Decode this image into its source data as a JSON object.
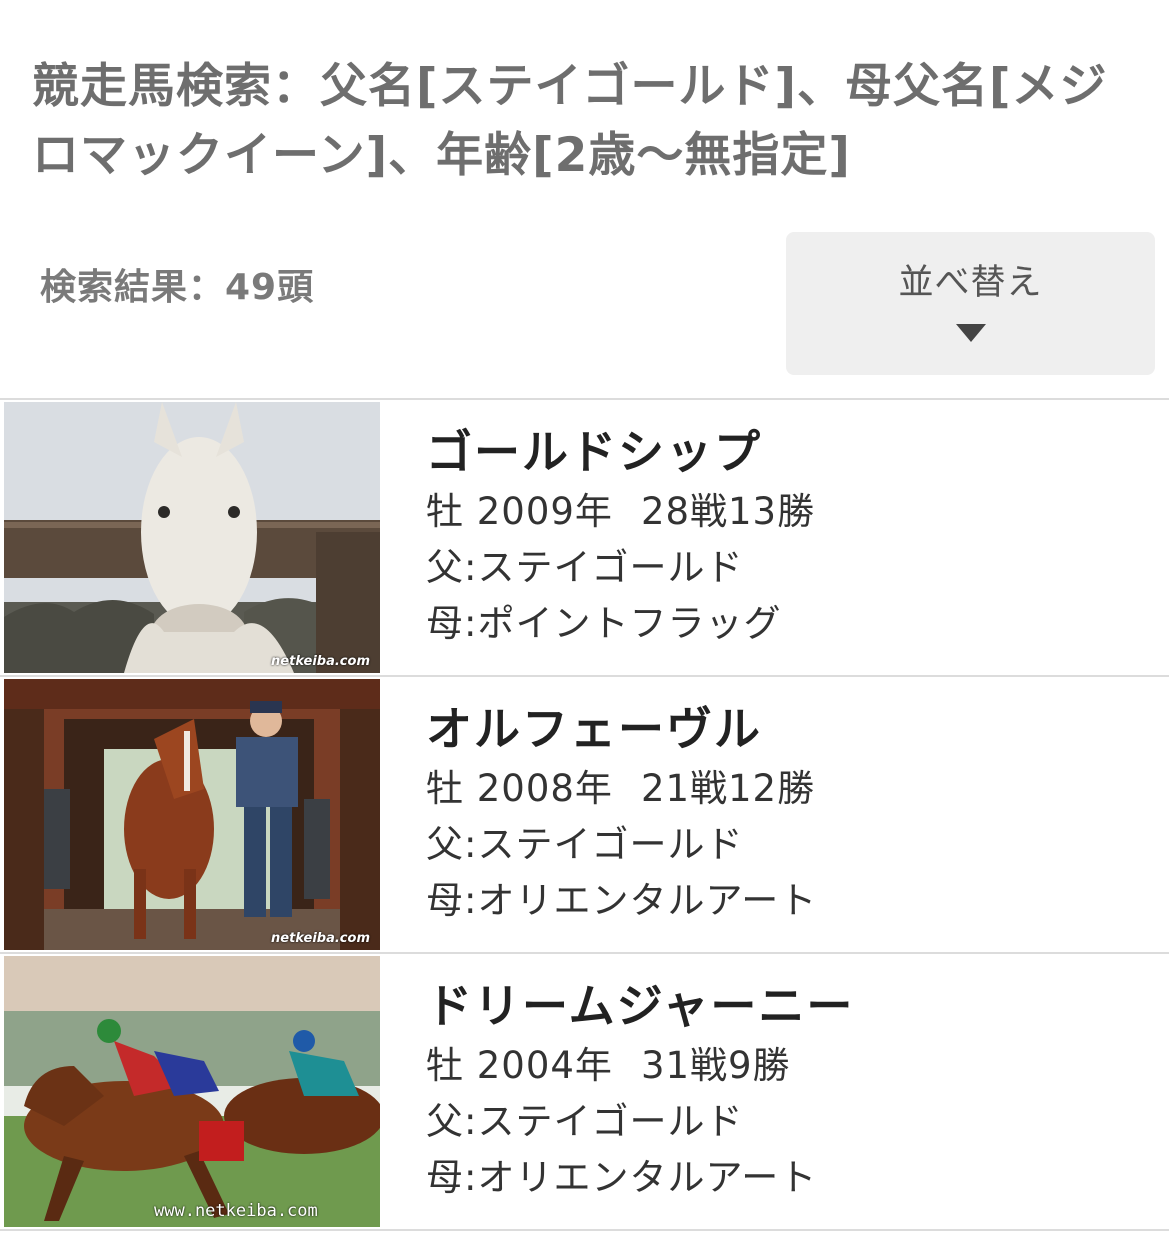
{
  "header": {
    "title": "競走馬検索：父名[ステイゴールド]、母父名[メジロマックイーン]、年齢[2歳〜無指定]",
    "result_count": "検索結果：49頭"
  },
  "sort": {
    "label": "並べ替え",
    "arrow_icon": "triangle-down-icon"
  },
  "results": [
    {
      "name": "ゴールドシップ",
      "sex_year": "牡 2009年",
      "record": "28戦13勝",
      "sire": "父:ステイゴールド",
      "dam": "母:ポイントフラッグ",
      "watermark": "netkeiba.com"
    },
    {
      "name": "オルフェーヴル",
      "sex_year": "牡 2008年",
      "record": "21戦12勝",
      "sire": "父:ステイゴールド",
      "dam": "母:オリエンタルアート",
      "watermark": "netkeiba.com"
    },
    {
      "name": "ドリームジャーニー",
      "sex_year": "牡 2004年",
      "record": "31戦9勝",
      "sire": "父:ステイゴールド",
      "dam": "母:オリエンタルアート",
      "watermark": "www.netkeiba.com"
    }
  ]
}
